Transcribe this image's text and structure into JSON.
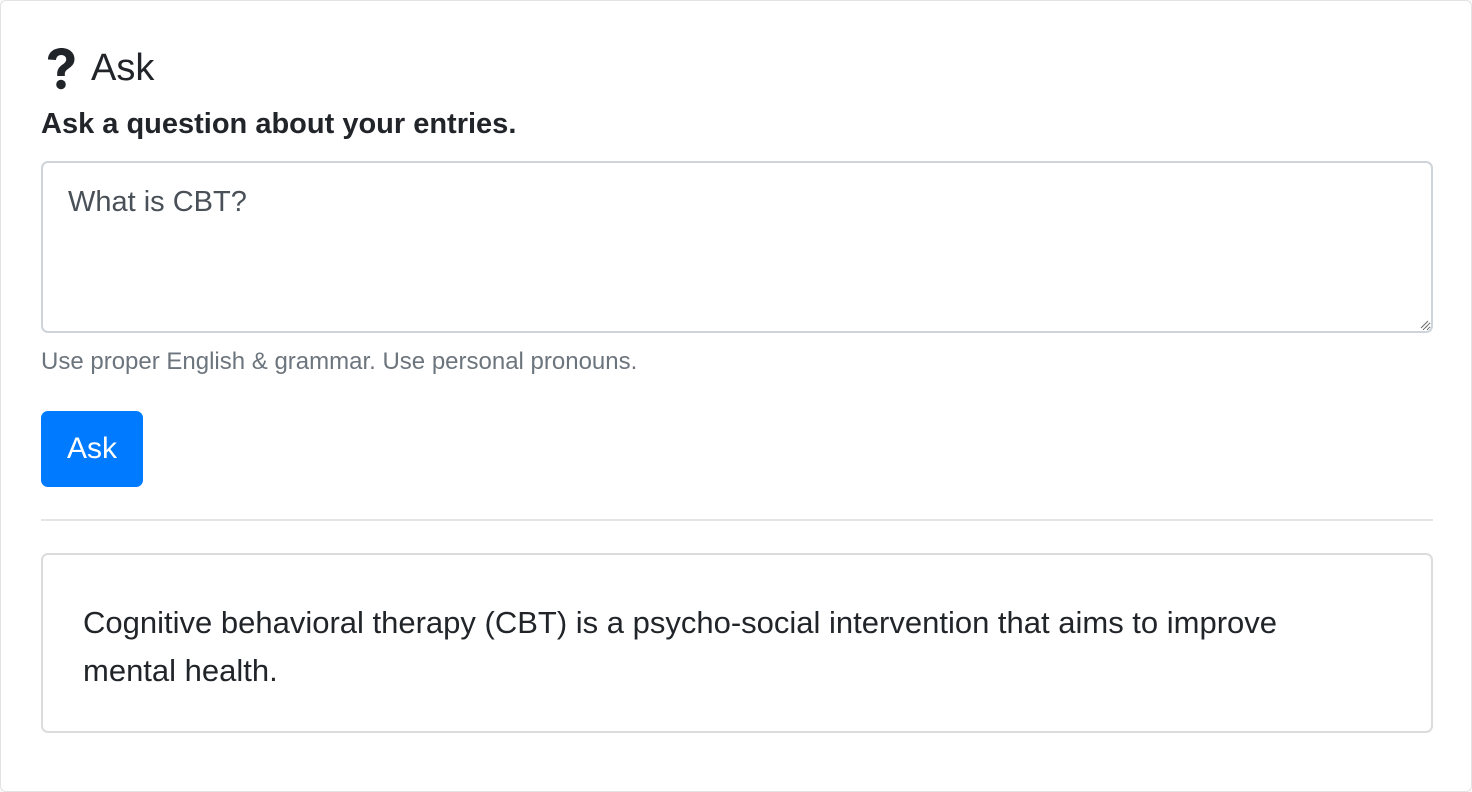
{
  "header": {
    "icon": "question-mark-icon",
    "title": "Ask"
  },
  "form": {
    "subtitle": "Ask a question about your entries.",
    "question_value": "What is CBT?",
    "helper_text": "Use proper English & grammar. Use personal pronouns.",
    "ask_label": "Ask"
  },
  "answer": {
    "text": "Cognitive behavioral therapy (CBT) is a psycho-social intervention that aims to improve mental health."
  },
  "colors": {
    "primary": "#007bff",
    "text": "#212529",
    "muted": "#6c757d",
    "border": "#ced4da"
  }
}
